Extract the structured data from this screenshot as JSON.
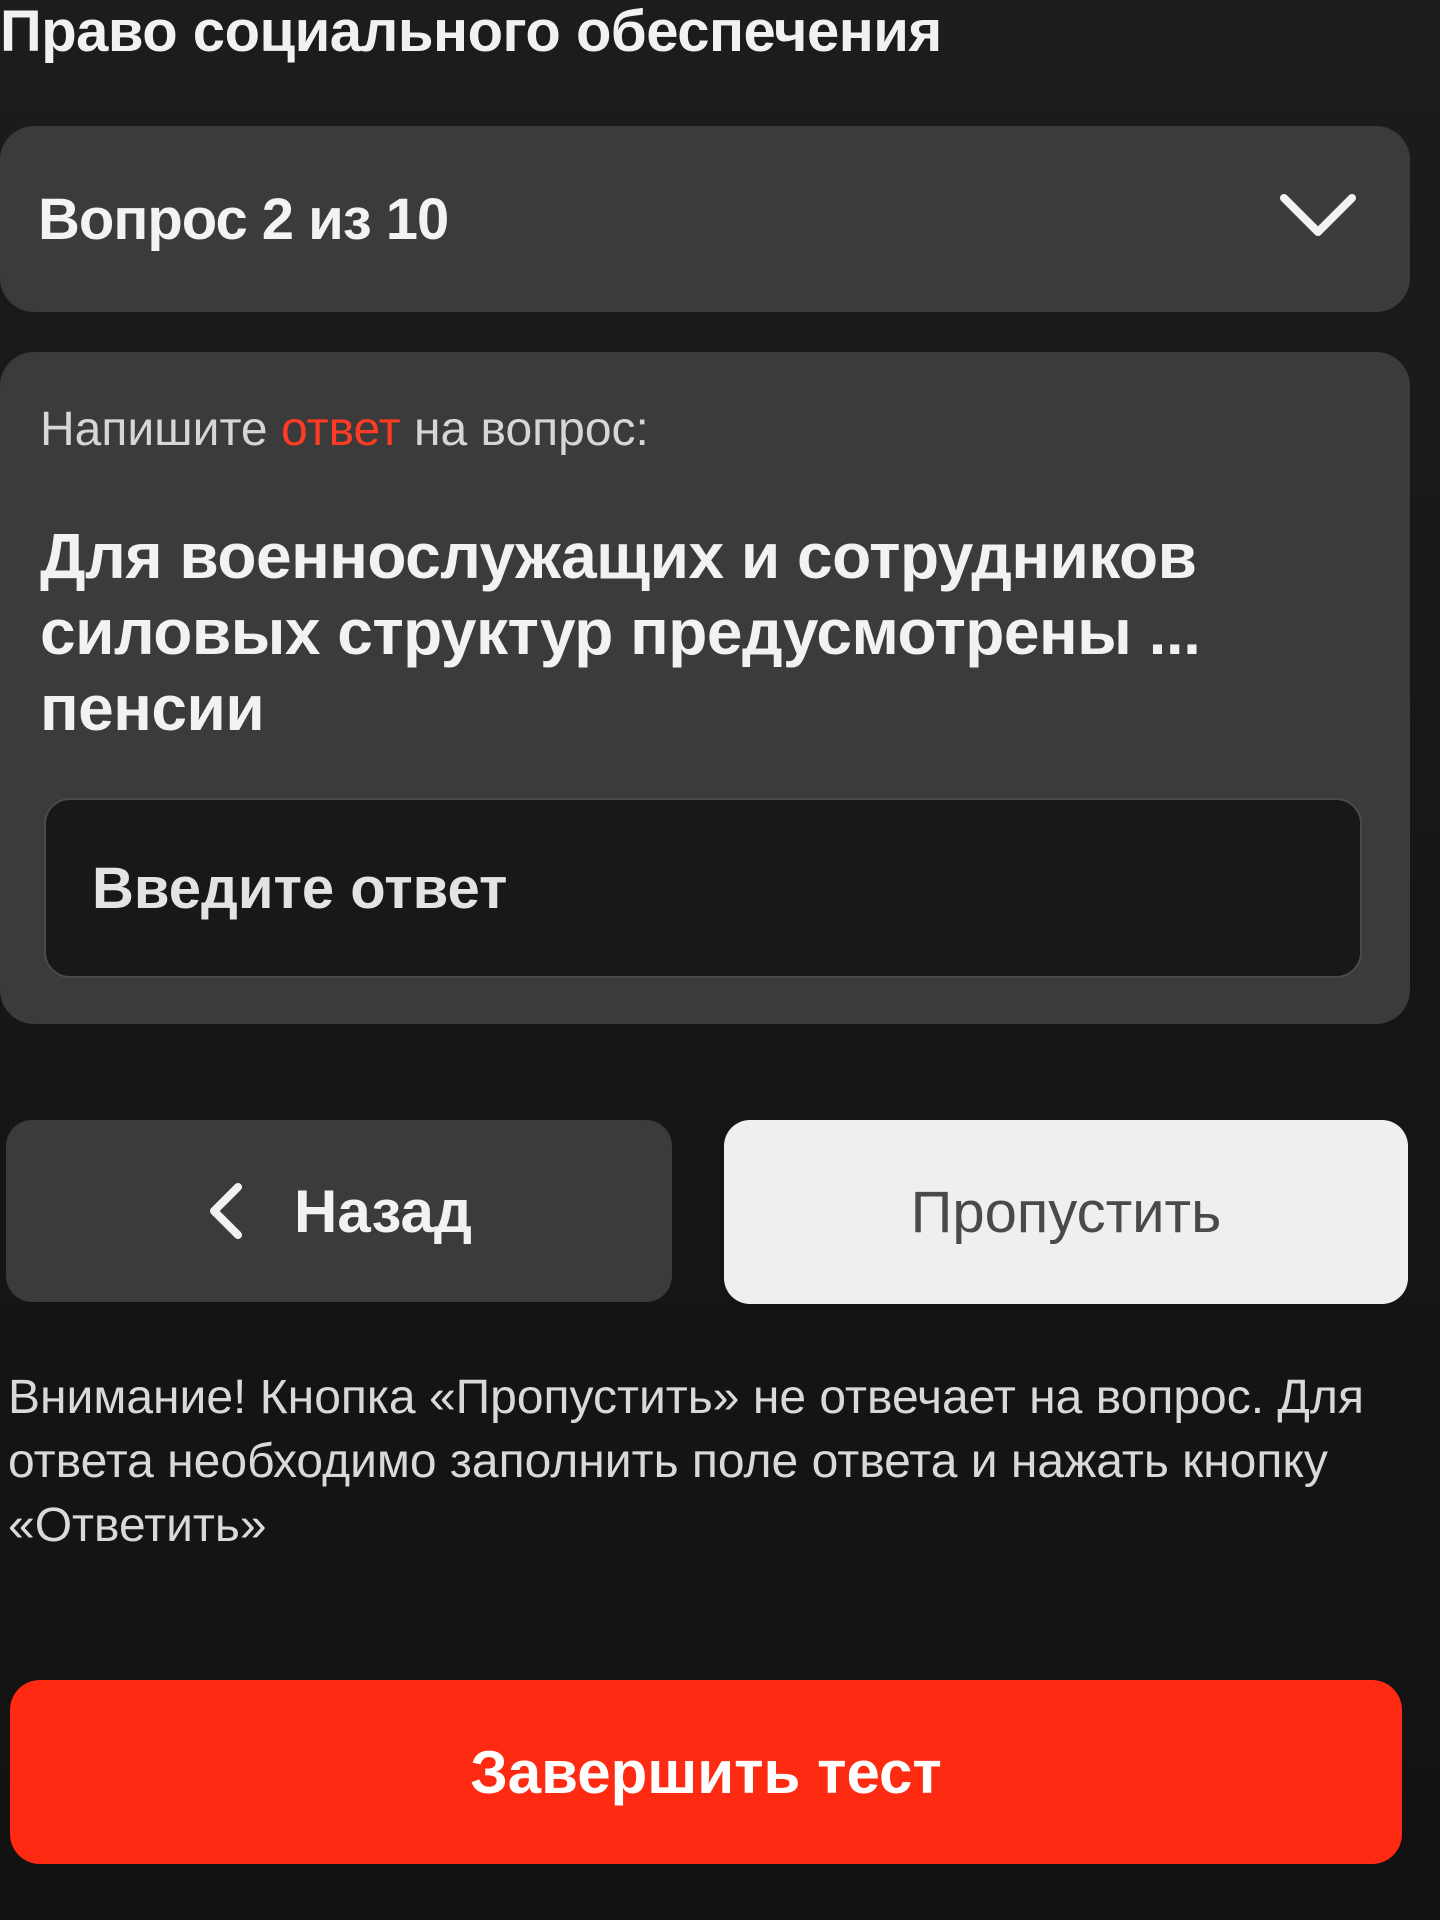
{
  "header": {
    "title": "Право социального обеспечения"
  },
  "question_selector": {
    "label": "Вопрос 2 из 10",
    "icon": "chevron-down-icon"
  },
  "question": {
    "instruction_before": "Напишите ",
    "instruction_accent": "ответ",
    "instruction_after": " на вопрос:",
    "text": "Для военнослужащих и сотрудников силовых структур предусмотрены ... пенсии",
    "answer_placeholder": "Введите ответ",
    "answer_value": ""
  },
  "actions": {
    "back_label": "Назад",
    "back_icon": "chevron-left-icon",
    "skip_label": "Пропустить",
    "finish_label": "Завершить тест"
  },
  "warning": "Внимание! Кнопка «Пропустить» не отвечает на вопрос. Для ответа необходимо заполнить поле ответа и нажать кнопку «Ответить»",
  "colors": {
    "accent": "#ff3b24",
    "finish_button": "#ff2a12",
    "card": "#3b3b3b",
    "background": "#151515"
  }
}
